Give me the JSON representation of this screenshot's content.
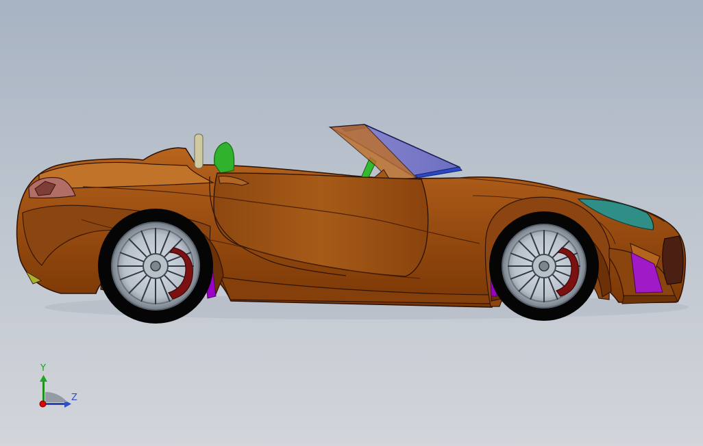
{
  "viewport": {
    "background": "#bfc7d0",
    "model_type": "cad-assembly-view",
    "model_subject": "convertible-car"
  },
  "triad": {
    "y_label": "Y",
    "z_label": "Z",
    "y_color": "#16a316",
    "z_color": "#2d4bc8",
    "x_color": "#e00000"
  },
  "car": {
    "body_color": "#9a4e11",
    "trim_color": "#7f3b08",
    "accent_green": "#2db32d",
    "accent_purple": "#a000c8",
    "windshield_color": "#7d7cc9",
    "wheel_color": "#c8cfd9",
    "brake_color": "#7c1111"
  }
}
